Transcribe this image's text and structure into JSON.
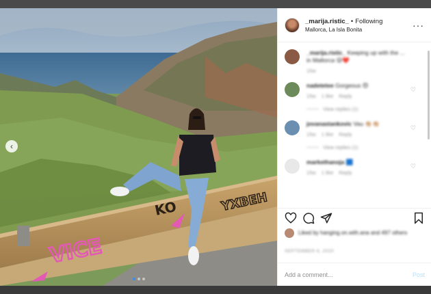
{
  "header": {
    "username": "_marija.ristic_",
    "separator": "•",
    "following": "Following",
    "location": "Mallorca, La Isla Bonita",
    "more": "···"
  },
  "photo": {
    "graffiti_left": "VICE",
    "graffiti_middle": "KO",
    "graffiti_right": "YXBEH",
    "current_slide": 1,
    "slide_count": 3
  },
  "comments": [
    {
      "user": "_marija.ristic_",
      "text": "Keeping up with the ... in Mallorca 😜❤️",
      "time": "15w",
      "likes": "",
      "reply": "",
      "replies": "",
      "color": "#8b5a44"
    },
    {
      "user": "nadetetee",
      "text": "Gorgeous 😍",
      "time": "15w",
      "likes": "1 like",
      "reply": "Reply",
      "replies": "View replies (1)",
      "color": "#6d8a5a"
    },
    {
      "user": "jovanastankovic",
      "text": "Vau 👏🏼👏🏼",
      "time": "15w",
      "likes": "1 like",
      "reply": "Reply",
      "replies": "View replies (1)",
      "color": "#6a8fb0"
    },
    {
      "user": "markethanoja",
      "text": "🟦",
      "time": "15w",
      "likes": "1 like",
      "reply": "Reply",
      "replies": "",
      "color": "#e8e8e8"
    }
  ],
  "likes_text": "Liked by hanging.on.with.ana and 497 others",
  "date": "SEPTEMBER 6, 2020",
  "add_comment": {
    "placeholder": "Add a comment...",
    "post_label": "Post"
  },
  "colors": {
    "post_button": "#b2dffc",
    "active_dot": "#3b8ef0"
  }
}
